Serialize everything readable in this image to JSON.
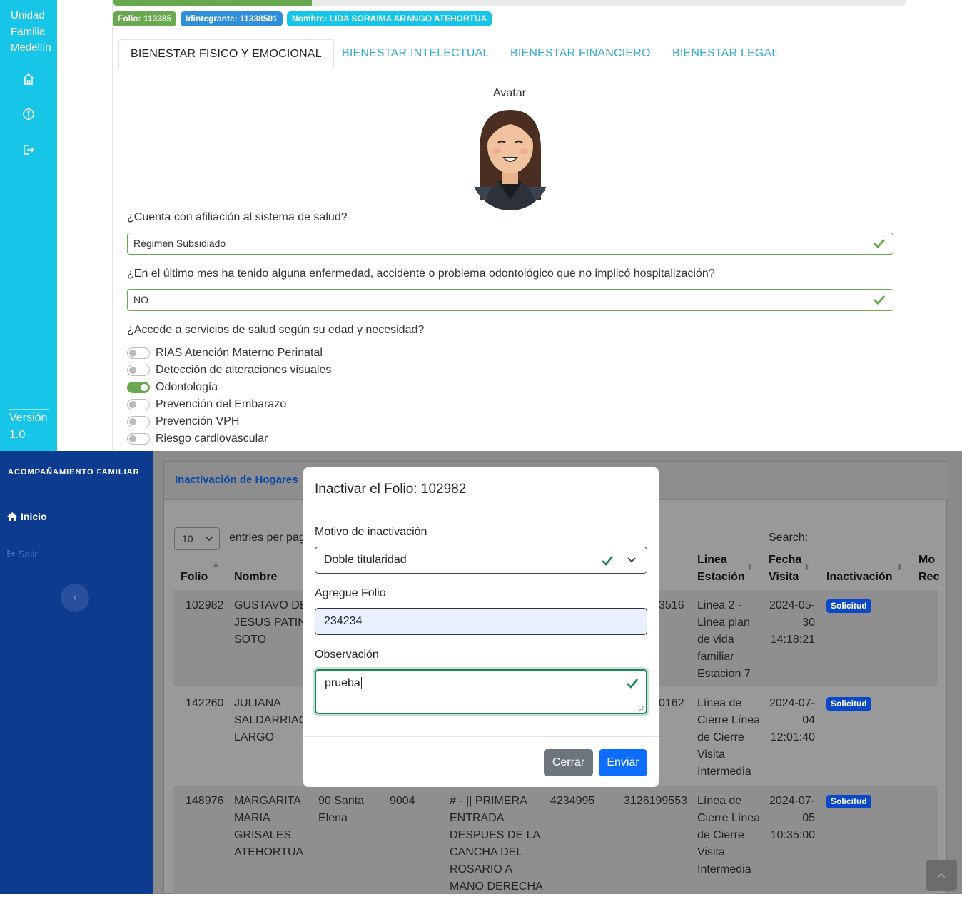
{
  "top": {
    "sidebar": {
      "brand": "Unidad Familia Medellín",
      "version": "Versión 1.0",
      "nav_icons": [
        "home-icon",
        "info-icon",
        "logout-icon"
      ]
    },
    "badges": {
      "folio": "Folio: 113385",
      "integrante": "Idintegrante: 11338501",
      "nombre": "Nombre: LIDA SORAIMA ARANGO ATEHORTUA"
    },
    "progress_fraction": 0.25,
    "tabs": [
      {
        "label": "BIENESTAR FISICO Y EMOCIONAL",
        "active": true
      },
      {
        "label": "BIENESTAR INTELECTUAL",
        "active": false
      },
      {
        "label": "BIENESTAR FINANCIERO",
        "active": false
      },
      {
        "label": "BIENESTAR LEGAL",
        "active": false
      }
    ],
    "avatar_label": "Avatar",
    "questions": {
      "q1": "¿Cuenta con afiliación al sistema de salud?",
      "a1": "Régimen Subsidiado",
      "q2": "¿En el último mes ha tenido alguna enfermedad, accidente o problema odontológico que no implicó hospitalización?",
      "a2": "NO",
      "q3": "¿Accede a servicios de salud según su edad y necesidad?"
    },
    "services": [
      {
        "label": "RIAS Atención Materno Perinatal",
        "on": false
      },
      {
        "label": "Detección de alteraciones visuales",
        "on": false
      },
      {
        "label": "Odontología",
        "on": true
      },
      {
        "label": "Prevención del Embarazo",
        "on": false
      },
      {
        "label": "Prevención VPH",
        "on": false
      },
      {
        "label": "Riesgo cardiovascular",
        "on": false
      }
    ],
    "colors": {
      "sidebar": "#17c5e8",
      "success": "#6aa84f",
      "info": "#17c5e8",
      "primary": "#2f8fd8"
    }
  },
  "bottom": {
    "sidebar": {
      "brand": "ACOMPAÑAMIENTO FAMILIAR",
      "inicio": "Inicio",
      "salir": "Salir"
    },
    "card_title": "Inactivación de Hogares",
    "entries_value": "10",
    "entries_label": "entries per pag",
    "search_label": "Search:",
    "headers": {
      "folio": "Folio",
      "nombre": "Nombre",
      "linea": "Linea\nEstación",
      "fecha": "Fecha\nVisita",
      "inactivacion": "Inactivación",
      "motivo": "Mo\nRec"
    },
    "rows": [
      {
        "folio": "102982",
        "nombre": "GUSTAVO DE\nJESUS PATINO\nSOTO",
        "c3": "",
        "c4": "",
        "c5": "",
        "c6": "",
        "c7": "3516",
        "linea": "Linea 2 -\nLinea plan\nde vida\nfamiliar\nEstacion 7",
        "fecha": "2024-05-\n30\n14:18:21",
        "badge": "Solicitud"
      },
      {
        "folio": "142260",
        "nombre": "JULIANA\nSALDARRIAGA\nLARGO",
        "c3": "",
        "c4": "",
        "c5": "",
        "c6": "",
        "c7": "0162",
        "linea": "Línea de\nCierre Línea\nde Cierre\nVisita\nIntermedia",
        "fecha": "2024-07-\n04\n12:01:40",
        "badge": "Solicitud"
      },
      {
        "folio": "148976",
        "nombre": "MARGARITA\nMARIA\nGRISALES\nATEHORTUA",
        "c3": "90 Santa\nElena",
        "c4": "9004",
        "c5": "# - || PRIMERA\nENTRADA\nDESPUES DE LA\nCANCHA DEL\nROSARIO A\nMANO DERECHA",
        "c6": "4234995",
        "c7": "3126199553",
        "linea": "Línea de\nCierre Línea\nde Cierre\nVisita\nIntermedia",
        "fecha": "2024-07-\n05\n10:35:00",
        "badge": "Solicitud"
      }
    ],
    "modal": {
      "title": "Inactivar el Folio: 102982",
      "motivo_label": "Motivo de inactivación",
      "motivo_value": "Doble titularidad",
      "folio_label": "Agregue Folio",
      "folio_value": "234234",
      "obs_label": "Observación",
      "obs_value": "prueba",
      "close_label": "Cerrar",
      "send_label": "Enviar"
    },
    "colors": {
      "sidebar": "#0c3b8f",
      "badge": "#0a47c9",
      "send": "#0d6efd",
      "close": "#6c757d",
      "valid": "#198754"
    }
  }
}
